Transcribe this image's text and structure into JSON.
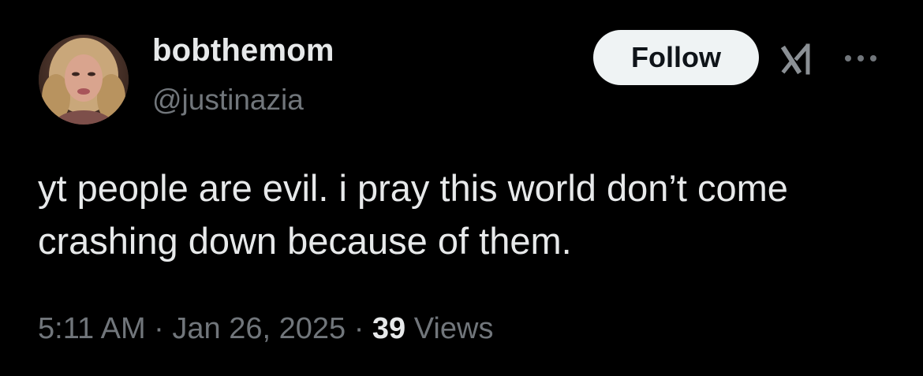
{
  "user": {
    "display_name": "bobthemom",
    "handle": "@justinazia"
  },
  "actions": {
    "follow_label": "Follow",
    "grok_icon": "grok-icon",
    "more_icon": "more-horizontal-icon"
  },
  "tweet": {
    "text": "yt people are evil. i pray this world don’t come crashing down because of them."
  },
  "meta": {
    "time": "5:11 AM",
    "separator": "·",
    "date": "Jan 26, 2025",
    "views_count": "39",
    "views_label": "Views"
  },
  "colors": {
    "background": "#000000",
    "primary_text": "#e7e9ea",
    "secondary_text": "#71767b",
    "follow_bg": "#eff3f4",
    "follow_text": "#0f1419"
  }
}
